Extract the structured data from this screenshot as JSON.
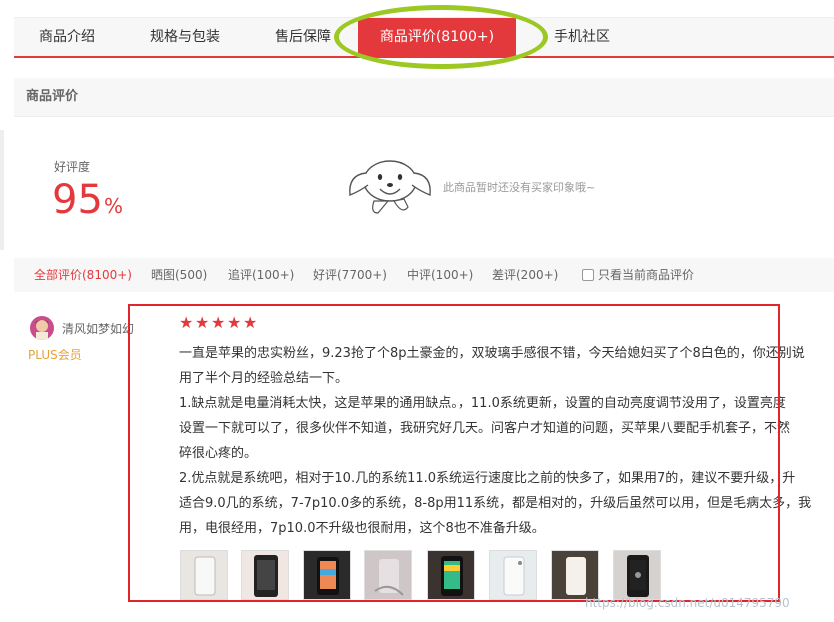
{
  "tabs": [
    {
      "label": "商品介绍",
      "active": false
    },
    {
      "label": "规格与包装",
      "active": false
    },
    {
      "label": "售后保障",
      "active": false
    },
    {
      "label": "商品评价(8100+)",
      "active": true
    },
    {
      "label": "手机社区",
      "active": false
    }
  ],
  "section_title": "商品评价",
  "rating": {
    "label": "好评度",
    "value": "95",
    "unit": "%"
  },
  "impression": {
    "mascot_icon": "jd-dog-mascot-icon",
    "empty_text": "此商品暂时还没有买家印象哦~"
  },
  "filters": {
    "items": [
      {
        "label": "全部评价(8100+)",
        "active": true
      },
      {
        "label": "晒图(500)",
        "active": false
      },
      {
        "label": "追评(100+)",
        "active": false
      },
      {
        "label": "好评(7700+)",
        "active": false
      },
      {
        "label": "中评(100+)",
        "active": false
      },
      {
        "label": "差评(200+)",
        "active": false
      }
    ],
    "only_current_label": "只看当前商品评价"
  },
  "review": {
    "username": "清风如梦如幻",
    "membership": "PLUS会员",
    "stars": 5,
    "lines": [
      "一直是苹果的忠实粉丝，9.23抢了个8p土豪金的，双玻璃手感很不错，今天给媳妇买了个8白色的，你还别说",
      "用了半个月的经验总结一下。",
      "1.缺点就是电量消耗太快，这是苹果的通用缺点。，11.0系统更新，设置的自动亮度调节没用了，设置亮度",
      "设置一下就可以了，很多伙伴不知道，我研究好几天。问客户才知道的问题，买苹果八要配手机套子，不然",
      "碎很心疼的。",
      "2.优点就是系统吧，相对于10.几的系统11.0系统运行速度比之前的快多了，如果用7的，建议不要升级，升",
      "适合9.0几的系统，7-7p10.0多的系统，8-8p用11系统，都是相对的，升级后虽然可以用，但是毛病太多，我",
      "用，电很经用，7p10.0不升级也很耐用，这个8也不准备升级。"
    ],
    "photo_count": 8
  },
  "watermark": "https://blog.csdn.net/u014795790",
  "colors": {
    "accent_red": "#e4393c",
    "highlight_box": "#e3242b",
    "highlight_ellipse": "#9cc823",
    "plus_gold": "#e6a23c"
  }
}
